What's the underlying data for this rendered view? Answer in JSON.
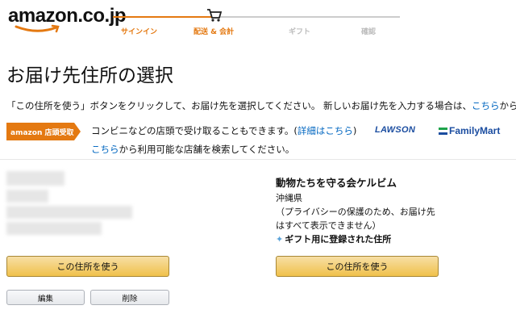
{
  "header": {
    "logo_text": "amazon.co.jp",
    "steps": [
      {
        "label": "サインイン",
        "state": "done"
      },
      {
        "label": "配送 & 会計",
        "state": "current"
      },
      {
        "label": "ギフト",
        "state": "future"
      },
      {
        "label": "確認",
        "state": "future"
      }
    ],
    "cart_icon": "cart-icon"
  },
  "page_title": "お届け先住所の選択",
  "instructions": {
    "before": "「この住所を使う」ボタンをクリックして、お届け先を選択してください。 新しいお届け先を入力する場合は、",
    "link": "こちら",
    "after": "から"
  },
  "pickup": {
    "badge": "amazon 店頭受取",
    "line1_before": "コンビニなどの店頭で受け取ることもできます。(",
    "line1_link": "詳細はこちら",
    "line1_after": ")",
    "line2_link": "こちら",
    "line2_after": "から利用可能な店舗を検索してください。",
    "partners": [
      "LAWSON",
      "FamilyMart"
    ]
  },
  "addresses": [
    {
      "blurred": true,
      "use_button": "この住所を使う",
      "edit_button": "編集",
      "delete_button": "削除"
    },
    {
      "name": "動物たちを守る会ケルビム",
      "prefecture": "沖縄県",
      "privacy_note": "（プライバシーの保護のため、お届け先はすべて表示できません）",
      "gift_tag": "ギフト用に登録された住所",
      "use_button": "この住所を使う"
    }
  ],
  "colors": {
    "accent": "#e47911",
    "link": "#0066c0",
    "button": "#f0c14b"
  }
}
